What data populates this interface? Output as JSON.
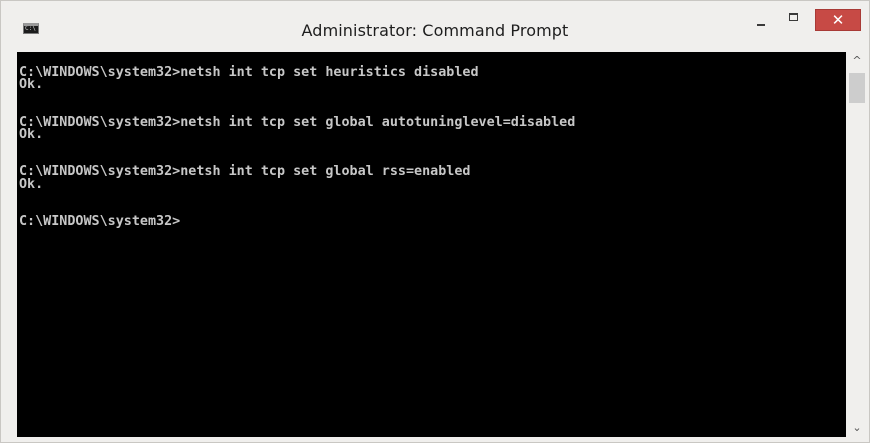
{
  "window": {
    "title": "Administrator: Command Prompt",
    "icon": "cmd-icon",
    "controls": {
      "minimize": "minimize-icon",
      "maximize": "maximize-icon",
      "close_glyph": "✕"
    }
  },
  "console": {
    "lines": [
      "C:\\WINDOWS\\system32>netsh int tcp set heuristics disabled",
      "Ok.",
      "",
      "",
      "C:\\WINDOWS\\system32>netsh int tcp set global autotuninglevel=disabled",
      "Ok.",
      "",
      "",
      "C:\\WINDOWS\\system32>netsh int tcp set global rss=enabled",
      "Ok.",
      "",
      "",
      "C:\\WINDOWS\\system32>"
    ]
  },
  "scrollbar": {
    "up_arrow": "^",
    "down_arrow": "⌄"
  },
  "colors": {
    "console_bg": "#000000",
    "console_fg": "#c7c7c7",
    "close_red": "#c74a45",
    "frame": "#f0efed"
  }
}
